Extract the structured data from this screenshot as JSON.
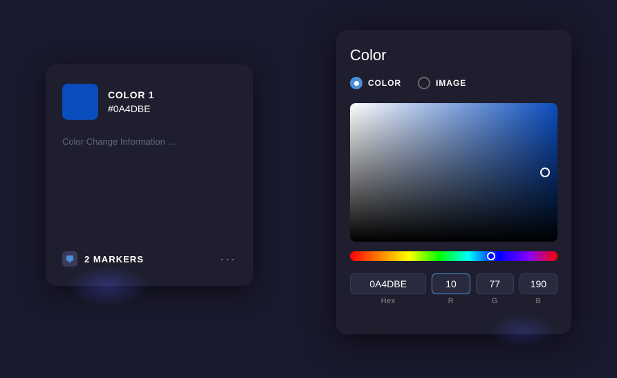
{
  "left_card": {
    "color_name": "COLOR 1",
    "color_hex": "#0A4DBE",
    "color_value": "#0A4DBE",
    "change_info": "Color Change Information ...",
    "markers_count": "2 MARKERS",
    "dots": "···"
  },
  "right_panel": {
    "title": "Color",
    "mode_color_label": "COLOR",
    "mode_image_label": "IMAGE",
    "hex_value": "0A4DBE",
    "hex_label": "Hex",
    "r_value": "10",
    "r_label": "R",
    "g_value": "77",
    "g_label": "G",
    "b_value": "190",
    "b_label": "B"
  }
}
